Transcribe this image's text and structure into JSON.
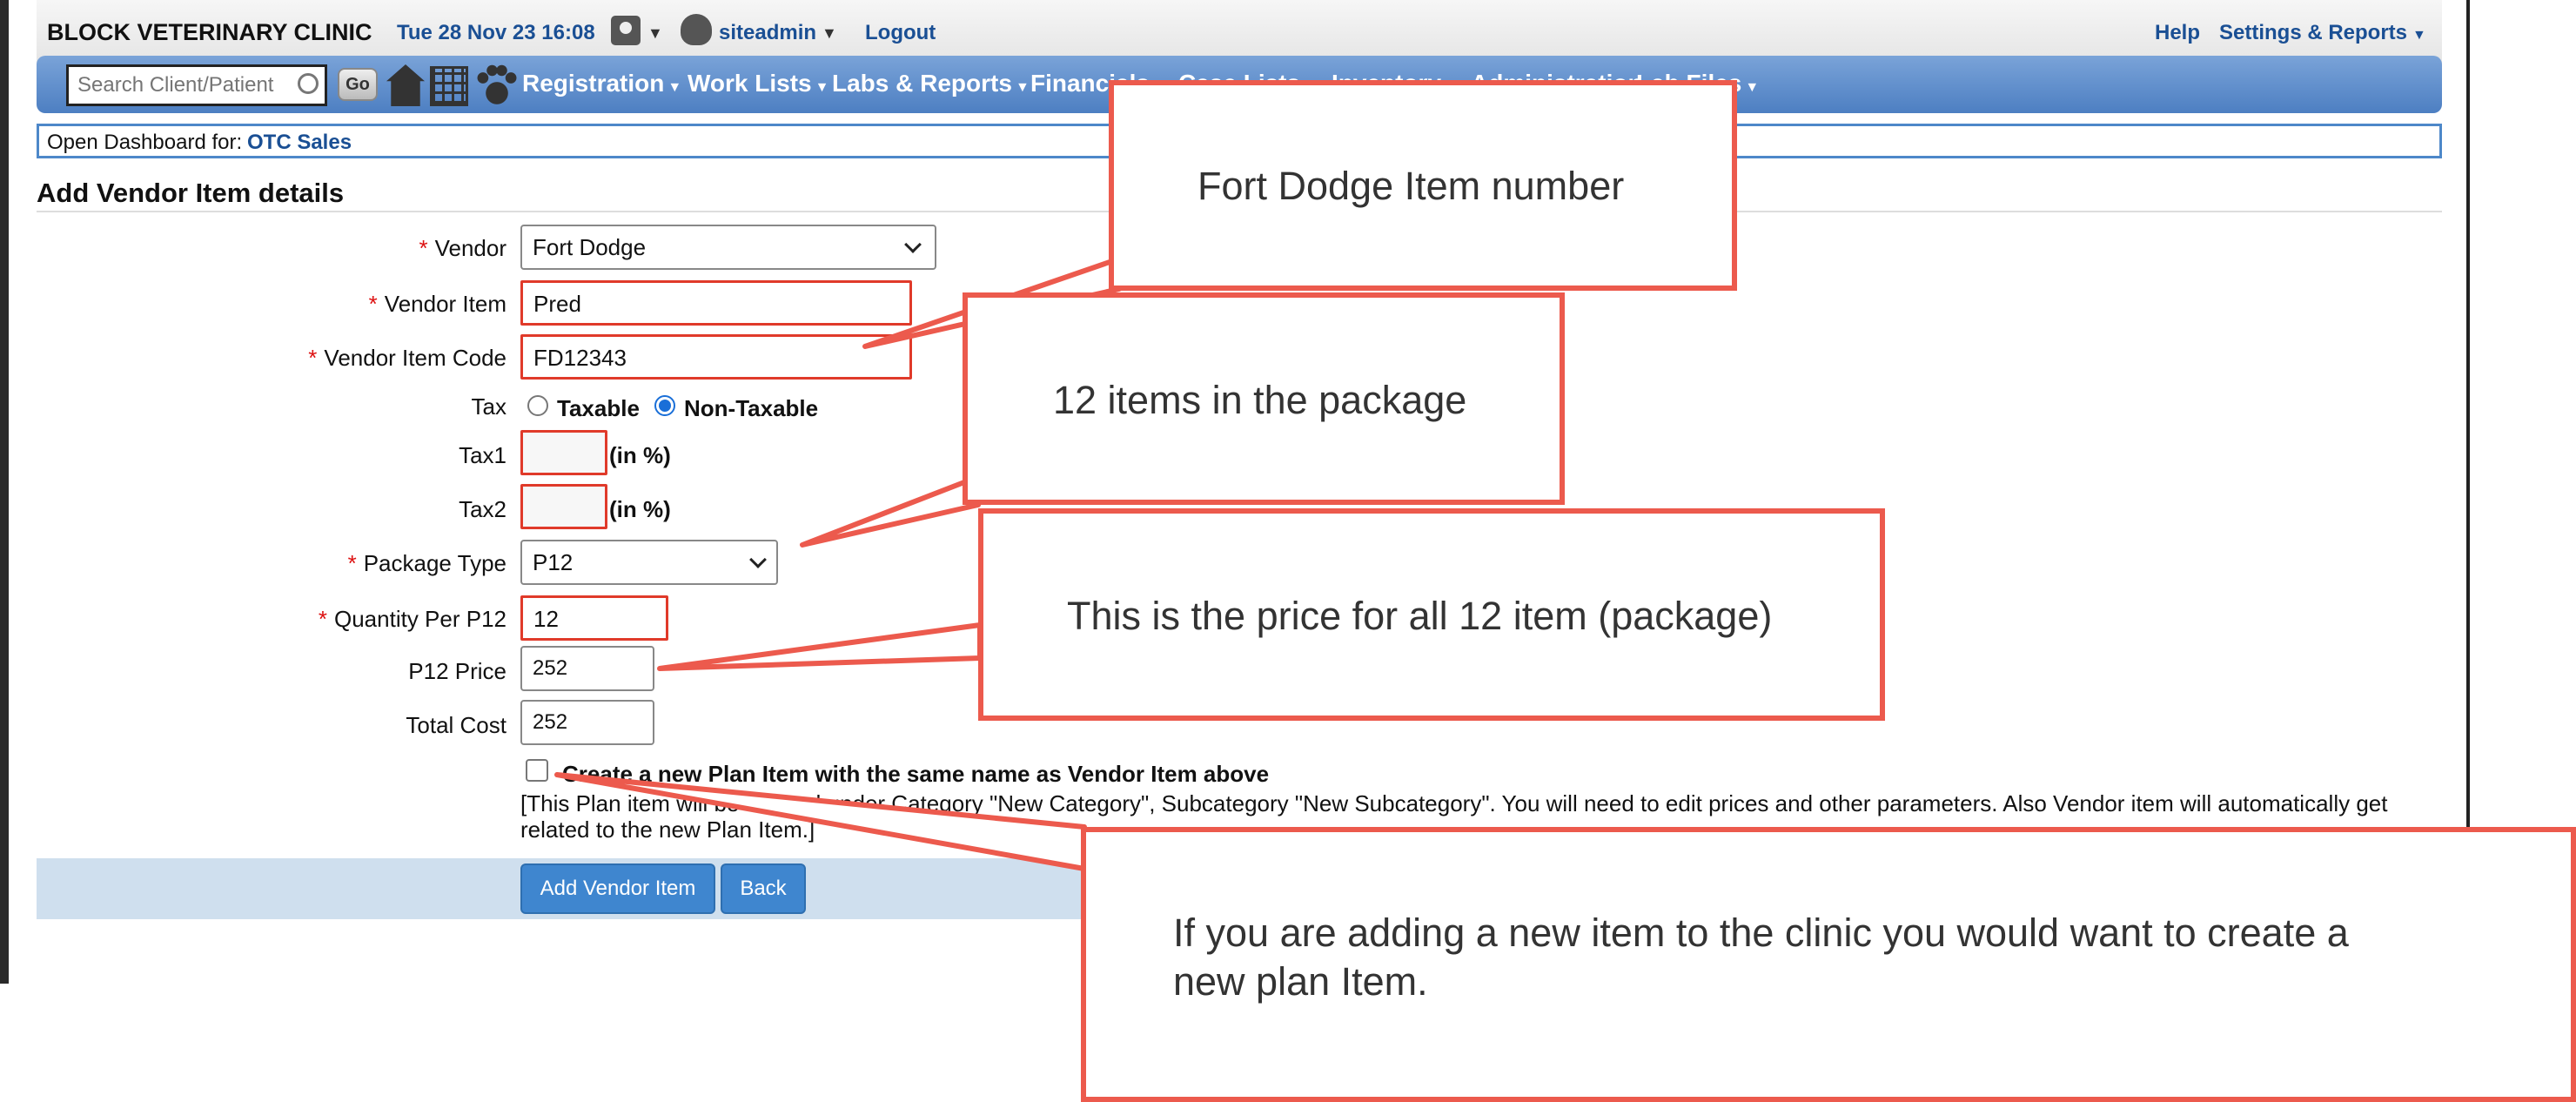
{
  "header": {
    "clinic_name": "BLOCK VETERINARY CLINIC",
    "datetime": "Tue 28 Nov 23 16:08",
    "username": "siteadmin",
    "logout": "Logout",
    "help": "Help",
    "settings": "Settings & Reports"
  },
  "nav": {
    "search_placeholder": "Search Client/Patient",
    "go": "Go",
    "items": [
      "Registration",
      "Work Lists",
      "Labs & Reports",
      "Financials",
      "Case Lists",
      "Inventory",
      "Administration",
      "Lab Files"
    ]
  },
  "dashboard": {
    "label": "Open Dashboard for:",
    "link": "OTC Sales"
  },
  "page_title": "Add Vendor Item details",
  "form": {
    "vendor": {
      "label": "Vendor",
      "value": "Fort Dodge"
    },
    "vendor_item": {
      "label": "Vendor Item",
      "value": "Pred"
    },
    "vendor_item_code": {
      "label": "Vendor Item Code",
      "value": "FD12343"
    },
    "tax": {
      "label": "Tax",
      "options": [
        "Taxable",
        "Non-Taxable"
      ],
      "selected": "Non-Taxable"
    },
    "tax1": {
      "label": "Tax1",
      "value": "",
      "unit": "(in %)"
    },
    "tax2": {
      "label": "Tax2",
      "value": "",
      "unit": "(in %)"
    },
    "package_type": {
      "label": "Package Type",
      "value": "P12"
    },
    "quantity": {
      "label": "Quantity Per P12",
      "value": "12"
    },
    "price": {
      "label": "P12 Price",
      "value": "252"
    },
    "total_cost": {
      "label": "Total Cost",
      "value": "252"
    },
    "create_plan": {
      "label": "Create a new Plan Item with the same name as Vendor Item above",
      "checked": false
    },
    "note": "[This Plan item will be created under Category \"New Category\", Subcategory \"New Subcategory\". You will need to edit prices and other parameters. Also Vendor item will automatically get related to the new Plan Item.]"
  },
  "buttons": {
    "add": "Add Vendor Item",
    "back": "Back"
  },
  "callouts": {
    "item_number": "Fort Dodge Item number",
    "package": "12 items in the package",
    "price": "This is the price for all 12 item (package)",
    "plan_item": "If you are adding a new item to the clinic you would want to create a new plan Item."
  },
  "colors": {
    "accent": "#1a4f94",
    "callout_border": "#ec5a4d",
    "required": "#d11111",
    "button": "#3f86cf"
  }
}
